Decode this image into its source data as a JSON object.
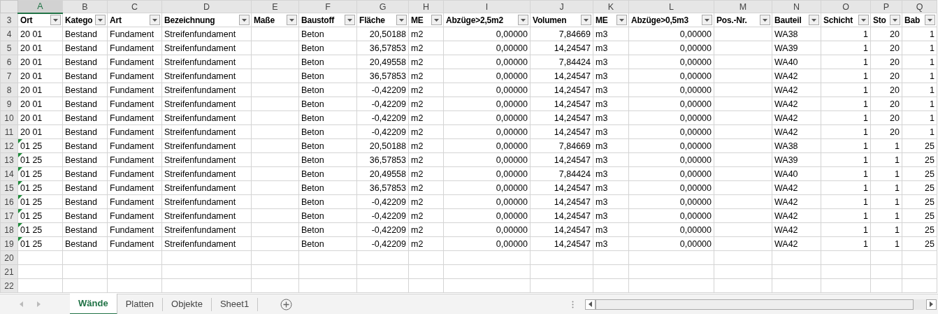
{
  "columns": [
    {
      "letter": "A",
      "header": "Ort",
      "kind": "text",
      "selected": true
    },
    {
      "letter": "B",
      "header": "Katego",
      "kind": "text",
      "selected": false
    },
    {
      "letter": "C",
      "header": "Art",
      "kind": "text",
      "selected": false
    },
    {
      "letter": "D",
      "header": "Bezeichnung",
      "kind": "text",
      "selected": false
    },
    {
      "letter": "E",
      "header": "Maße",
      "kind": "text",
      "selected": false
    },
    {
      "letter": "F",
      "header": "Baustoff",
      "kind": "text",
      "selected": false
    },
    {
      "letter": "G",
      "header": "Fläche",
      "kind": "number",
      "selected": false
    },
    {
      "letter": "H",
      "header": "ME",
      "kind": "text",
      "selected": false
    },
    {
      "letter": "I",
      "header": "Abzüge>2,5m2",
      "kind": "number",
      "selected": false
    },
    {
      "letter": "J",
      "header": "Volumen",
      "kind": "number",
      "selected": false
    },
    {
      "letter": "K",
      "header": "ME",
      "kind": "text",
      "selected": false
    },
    {
      "letter": "L",
      "header": "Abzüge>0,5m3",
      "kind": "number",
      "selected": false
    },
    {
      "letter": "M",
      "header": "Pos.-Nr.",
      "kind": "text",
      "selected": false
    },
    {
      "letter": "N",
      "header": "Bauteil",
      "kind": "text",
      "selected": false
    },
    {
      "letter": "O",
      "header": "Schicht",
      "kind": "number",
      "selected": false
    },
    {
      "letter": "P",
      "header": "Sto",
      "kind": "number",
      "selected": false
    },
    {
      "letter": "Q",
      "header": "Bab",
      "kind": "number",
      "selected": false
    }
  ],
  "header_row": "3",
  "rows": [
    {
      "number": "4",
      "flag": false,
      "cells": [
        "20 01",
        "Bestand",
        "Fundament",
        "Streifenfundament",
        null,
        "Beton",
        "20,50188",
        "m2",
        "0,00000",
        "7,84669",
        "m3",
        "0,00000",
        null,
        "WA38",
        "1",
        "20",
        "1"
      ]
    },
    {
      "number": "5",
      "flag": false,
      "cells": [
        "20 01",
        "Bestand",
        "Fundament",
        "Streifenfundament",
        null,
        "Beton",
        "36,57853",
        "m2",
        "0,00000",
        "14,24547",
        "m3",
        "0,00000",
        null,
        "WA39",
        "1",
        "20",
        "1"
      ]
    },
    {
      "number": "6",
      "flag": false,
      "cells": [
        "20 01",
        "Bestand",
        "Fundament",
        "Streifenfundament",
        null,
        "Beton",
        "20,49558",
        "m2",
        "0,00000",
        "7,84424",
        "m3",
        "0,00000",
        null,
        "WA40",
        "1",
        "20",
        "1"
      ]
    },
    {
      "number": "7",
      "flag": false,
      "cells": [
        "20 01",
        "Bestand",
        "Fundament",
        "Streifenfundament",
        null,
        "Beton",
        "36,57853",
        "m2",
        "0,00000",
        "14,24547",
        "m3",
        "0,00000",
        null,
        "WA42",
        "1",
        "20",
        "1"
      ]
    },
    {
      "number": "8",
      "flag": false,
      "cells": [
        "20 01",
        "Bestand",
        "Fundament",
        "Streifenfundament",
        null,
        "Beton",
        "-0,42209",
        "m2",
        "0,00000",
        "14,24547",
        "m3",
        "0,00000",
        null,
        "WA42",
        "1",
        "20",
        "1"
      ]
    },
    {
      "number": "9",
      "flag": false,
      "cells": [
        "20 01",
        "Bestand",
        "Fundament",
        "Streifenfundament",
        null,
        "Beton",
        "-0,42209",
        "m2",
        "0,00000",
        "14,24547",
        "m3",
        "0,00000",
        null,
        "WA42",
        "1",
        "20",
        "1"
      ]
    },
    {
      "number": "10",
      "flag": false,
      "cells": [
        "20 01",
        "Bestand",
        "Fundament",
        "Streifenfundament",
        null,
        "Beton",
        "-0,42209",
        "m2",
        "0,00000",
        "14,24547",
        "m3",
        "0,00000",
        null,
        "WA42",
        "1",
        "20",
        "1"
      ]
    },
    {
      "number": "11",
      "flag": false,
      "cells": [
        "20 01",
        "Bestand",
        "Fundament",
        "Streifenfundament",
        null,
        "Beton",
        "-0,42209",
        "m2",
        "0,00000",
        "14,24547",
        "m3",
        "0,00000",
        null,
        "WA42",
        "1",
        "20",
        "1"
      ]
    },
    {
      "number": "12",
      "flag": true,
      "cells": [
        "01 25",
        "Bestand",
        "Fundament",
        "Streifenfundament",
        null,
        "Beton",
        "20,50188",
        "m2",
        "0,00000",
        "7,84669",
        "m3",
        "0,00000",
        null,
        "WA38",
        "1",
        "1",
        "25"
      ]
    },
    {
      "number": "13",
      "flag": true,
      "cells": [
        "01 25",
        "Bestand",
        "Fundament",
        "Streifenfundament",
        null,
        "Beton",
        "36,57853",
        "m2",
        "0,00000",
        "14,24547",
        "m3",
        "0,00000",
        null,
        "WA39",
        "1",
        "1",
        "25"
      ]
    },
    {
      "number": "14",
      "flag": true,
      "cells": [
        "01 25",
        "Bestand",
        "Fundament",
        "Streifenfundament",
        null,
        "Beton",
        "20,49558",
        "m2",
        "0,00000",
        "7,84424",
        "m3",
        "0,00000",
        null,
        "WA40",
        "1",
        "1",
        "25"
      ]
    },
    {
      "number": "15",
      "flag": true,
      "cells": [
        "01 25",
        "Bestand",
        "Fundament",
        "Streifenfundament",
        null,
        "Beton",
        "36,57853",
        "m2",
        "0,00000",
        "14,24547",
        "m3",
        "0,00000",
        null,
        "WA42",
        "1",
        "1",
        "25"
      ]
    },
    {
      "number": "16",
      "flag": true,
      "cells": [
        "01 25",
        "Bestand",
        "Fundament",
        "Streifenfundament",
        null,
        "Beton",
        "-0,42209",
        "m2",
        "0,00000",
        "14,24547",
        "m3",
        "0,00000",
        null,
        "WA42",
        "1",
        "1",
        "25"
      ]
    },
    {
      "number": "17",
      "flag": true,
      "cells": [
        "01 25",
        "Bestand",
        "Fundament",
        "Streifenfundament",
        null,
        "Beton",
        "-0,42209",
        "m2",
        "0,00000",
        "14,24547",
        "m3",
        "0,00000",
        null,
        "WA42",
        "1",
        "1",
        "25"
      ]
    },
    {
      "number": "18",
      "flag": true,
      "cells": [
        "01 25",
        "Bestand",
        "Fundament",
        "Streifenfundament",
        null,
        "Beton",
        "-0,42209",
        "m2",
        "0,00000",
        "14,24547",
        "m3",
        "0,00000",
        null,
        "WA42",
        "1",
        "1",
        "25"
      ]
    },
    {
      "number": "19",
      "flag": true,
      "cells": [
        "01 25",
        "Bestand",
        "Fundament",
        "Streifenfundament",
        null,
        "Beton",
        "-0,42209",
        "m2",
        "0,00000",
        "14,24547",
        "m3",
        "0,00000",
        null,
        "WA42",
        "1",
        "1",
        "25"
      ]
    }
  ],
  "empty_rows": [
    "20",
    "21",
    "22"
  ],
  "sheet_tabs": [
    {
      "label": "Wände",
      "selected": true
    },
    {
      "label": "Platten",
      "selected": false
    },
    {
      "label": "Objekte",
      "selected": false
    },
    {
      "label": "Sheet1",
      "selected": false
    }
  ]
}
